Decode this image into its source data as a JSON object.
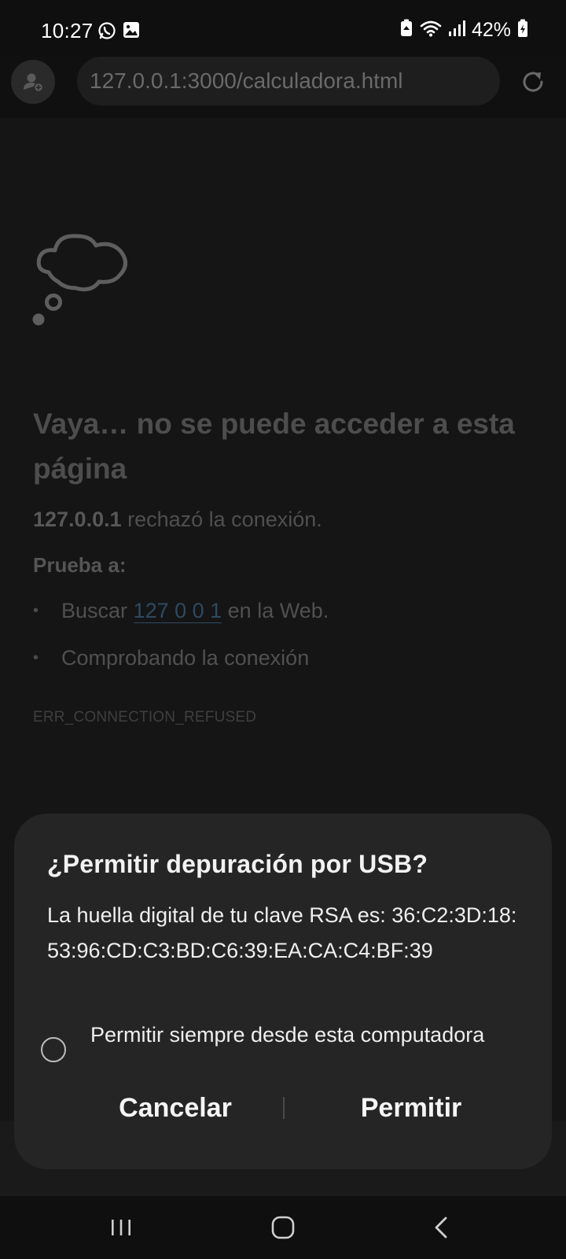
{
  "status_bar": {
    "time": "10:27",
    "battery_percent": "42%",
    "icons_left": [
      "whatsapp-icon",
      "gallery-icon"
    ],
    "icons_right": [
      "battery-saver-icon",
      "wifi-icon",
      "signal-icon",
      "battery-icon"
    ]
  },
  "browser": {
    "url": "127.0.0.1:3000/calculadora.html"
  },
  "error_page": {
    "title": "Vaya… no se puede acceder a esta página",
    "host": "127.0.0.1",
    "message": " rechazó la conexión.",
    "try_label": "Prueba a:",
    "suggestion_search_prefix": "Buscar ",
    "suggestion_search_link": "127 0 0 1",
    "suggestion_search_suffix": " en la Web.",
    "suggestion_check": "Comprobando la conexión",
    "error_code": "ERR_CONNECTION_REFUSED"
  },
  "dialog": {
    "title": "¿Permitir depuración por USB?",
    "body": "La huella digital de tu clave RSA es: 36:C2:3D:18:53:96:CD:C3:BD:C6:39:EA:CA:C4:BF:39",
    "checkbox_label": "Permitir siempre desde esta computadora",
    "checkbox_checked": false,
    "cancel_label": "Cancelar",
    "allow_label": "Permitir"
  },
  "nav_bar": {
    "buttons": [
      "recents-icon",
      "home-icon",
      "back-icon"
    ]
  }
}
